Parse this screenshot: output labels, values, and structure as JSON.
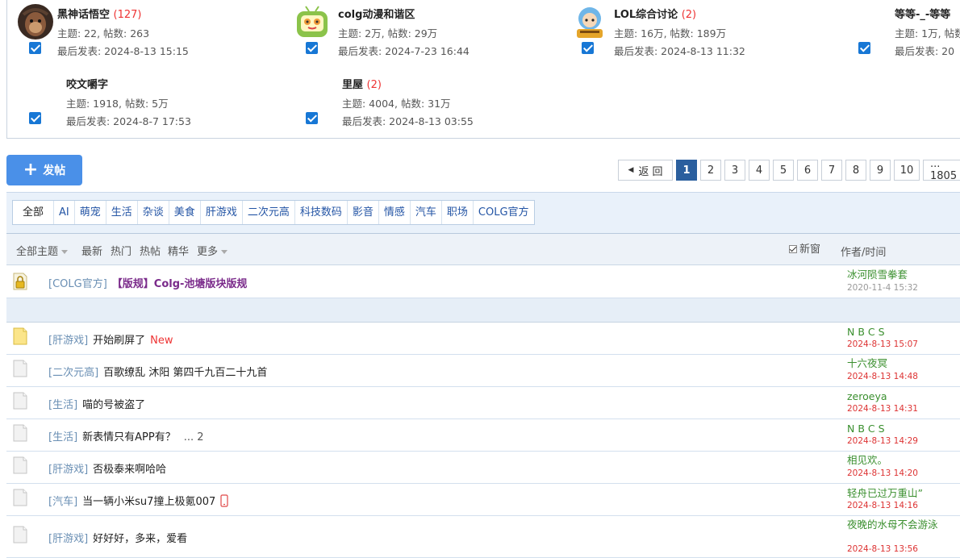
{
  "forums": [
    {
      "name": "黑神话悟空",
      "count": "(127)",
      "stats": "主题: 22, 帖数: 263",
      "last": "最后发表: 2024-8-13 15:15",
      "icon": "wukong-avatar-icon"
    },
    {
      "name": "colg动漫和谐区",
      "count": "",
      "stats": "主题: 2万, 帖数: 29万",
      "last": "最后发表: 2024-7-23 16:44",
      "icon": "tv-mascot-icon"
    },
    {
      "name": "LOL综合讨论",
      "count": "(2)",
      "stats": "主题: 16万, 帖数: 189万",
      "last": "最后发表: 2024-8-13 11:32",
      "icon": "lol-mascot-icon"
    },
    {
      "name": "等等-_-等等",
      "count": "",
      "stats": "主题: 1万, 帖数",
      "last": "最后发表: 20",
      "icon": ""
    },
    {
      "name": "咬文嚼字",
      "count": "",
      "stats": "主题: 1918, 帖数: 5万",
      "last": "最后发表: 2024-8-7 17:53",
      "icon": ""
    },
    {
      "name": "里屋",
      "count": "(2)",
      "stats": "主题: 4004, 帖数: 31万",
      "last": "最后发表: 2024-8-13 03:55",
      "icon": ""
    }
  ],
  "post_button": "发帖",
  "pagination": {
    "back": "返 回",
    "pages": [
      "1",
      "2",
      "3",
      "4",
      "5",
      "6",
      "7",
      "8",
      "9",
      "10"
    ],
    "current": "1",
    "last": "... 1805"
  },
  "categories": [
    "全部",
    "AI",
    "萌宠",
    "生活",
    "杂谈",
    "美食",
    "肝游戏",
    "二次元高",
    "科技数码",
    "影音",
    "情感",
    "汽车",
    "职场",
    "COLG官方"
  ],
  "active_category": "全部",
  "thread_header": {
    "all_topics": "全部主题",
    "filters": [
      "最新",
      "热门",
      "热帖",
      "精华",
      "更多"
    ],
    "new_window": "新窗",
    "author_time": "作者/时间"
  },
  "threads": [
    {
      "category": "[COLG官方]",
      "title": "【版规】Colg-池塘版块版规",
      "new": "",
      "pages": "",
      "author": "冰河陨雪拳套",
      "time": "2020-11-4 15:32",
      "sticky": true,
      "recent": false,
      "icon": "lock-thread-icon",
      "phone": false
    },
    {
      "category": "[肝游戏]",
      "title": "开始刷屏了",
      "new": "New",
      "pages": "",
      "author": "N B C S",
      "time": "2024-8-13 15:07",
      "sticky": false,
      "recent": true,
      "icon": "new-thread-icon",
      "phone": false
    },
    {
      "category": "[二次元高]",
      "title": "百歌缭乱 沐阳 第四千九百二十九首",
      "new": "",
      "pages": "",
      "author": "十六夜冥",
      "time": "2024-8-13 14:48",
      "sticky": false,
      "recent": true,
      "icon": "thread-icon",
      "phone": false
    },
    {
      "category": "[生活]",
      "title": "喵的号被盗了",
      "new": "",
      "pages": "",
      "author": "zeroeya",
      "time": "2024-8-13 14:31",
      "sticky": false,
      "recent": true,
      "icon": "thread-icon",
      "phone": false
    },
    {
      "category": "[生活]",
      "title": "新表情只有APP有？",
      "new": "",
      "pages": "... 2",
      "author": "N B C S",
      "time": "2024-8-13 14:29",
      "sticky": false,
      "recent": true,
      "icon": "thread-icon",
      "phone": false
    },
    {
      "category": "[肝游戏]",
      "title": "否极泰来啊哈哈",
      "new": "",
      "pages": "",
      "author": "相见欢。",
      "time": "2024-8-13 14:20",
      "sticky": false,
      "recent": true,
      "icon": "thread-icon",
      "phone": false
    },
    {
      "category": "[汽车]",
      "title": "当一辆小米su7撞上极氪007",
      "new": "",
      "pages": "",
      "author": "轻舟已过万重山”",
      "time": "2024-8-13 14:16",
      "sticky": false,
      "recent": true,
      "icon": "thread-icon",
      "phone": true
    },
    {
      "category": "[肝游戏]",
      "title": "好好好，多来，爱看",
      "new": "",
      "pages": "",
      "author": "夜晚的水母不会游泳",
      "time": "2024-8-13 13:56",
      "sticky": false,
      "recent": true,
      "icon": "thread-icon",
      "phone": false
    }
  ],
  "colors": {
    "accent": "#4a90e8",
    "active_page": "#2b5f9e",
    "author": "#3a8f2e",
    "recent_time": "#d33",
    "new_tag": "#e33"
  }
}
